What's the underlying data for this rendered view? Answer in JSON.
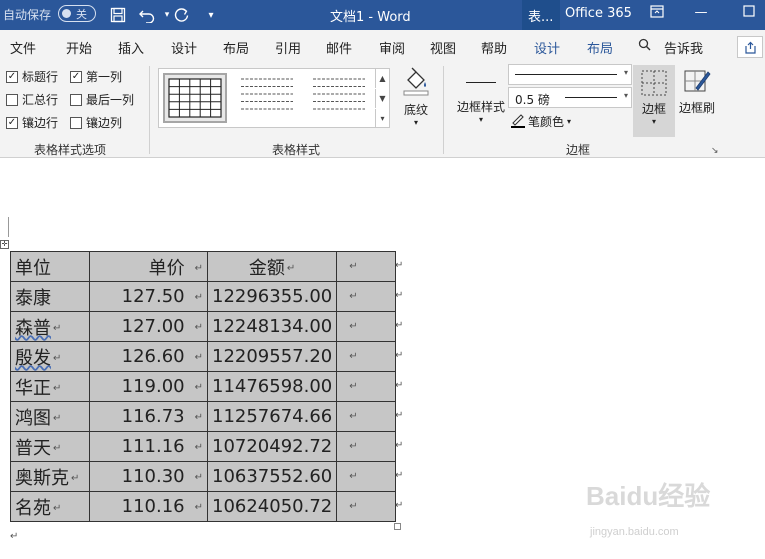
{
  "titlebar": {
    "autosave_label": "自动保存",
    "autosave_state": "关",
    "doc_title": "文档1  -  Word",
    "context_tab": "表...",
    "office": "Office 365"
  },
  "tabs": [
    "文件",
    "开始",
    "插入",
    "设计",
    "布局",
    "引用",
    "邮件",
    "审阅",
    "视图",
    "帮助",
    "设计",
    "布局"
  ],
  "tell_me": "告诉我",
  "style_options": {
    "items": [
      {
        "label": "标题行",
        "checked": true
      },
      {
        "label": "第一列",
        "checked": true
      },
      {
        "label": "汇总行",
        "checked": false
      },
      {
        "label": "最后一列",
        "checked": false
      },
      {
        "label": "镶边行",
        "checked": true
      },
      {
        "label": "镶边列",
        "checked": false
      }
    ],
    "group_label": "表格样式选项"
  },
  "table_styles": {
    "group_label": "表格样式"
  },
  "shading": {
    "label": "底纹"
  },
  "borders": {
    "border_styles_label": "边框样式",
    "weight": "0.5 磅",
    "pen_color": "笔颜色",
    "border_label": "边框",
    "painter_label": "边框刷",
    "group_label": "边框"
  },
  "table": {
    "headers": [
      "单位",
      "单价",
      "金额",
      ""
    ],
    "rows": [
      [
        "泰康",
        "127.50",
        "12296355.00",
        ""
      ],
      [
        "森普",
        "127.00",
        "12248134.00",
        ""
      ],
      [
        "殷发",
        "126.60",
        "12209557.20",
        ""
      ],
      [
        "华正",
        "119.00",
        "11476598.00",
        ""
      ],
      [
        "鸿图",
        "116.73",
        "11257674.66",
        ""
      ],
      [
        "普天",
        "111.16",
        "10720492.72",
        ""
      ],
      [
        "奥斯克",
        "110.30",
        "10637552.60",
        ""
      ],
      [
        "名苑",
        "110.16",
        "10624050.72",
        ""
      ]
    ]
  },
  "colors": {
    "accent": "#2b579a",
    "cell_fill": "#c6c6c6"
  },
  "watermark": {
    "logo": "Baidu经验",
    "url": "jingyan.baidu.com"
  }
}
